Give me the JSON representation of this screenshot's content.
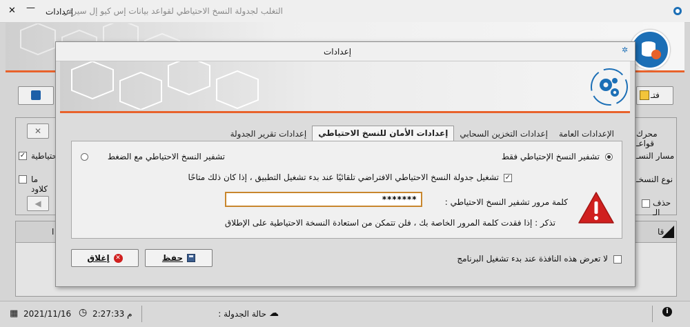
{
  "window": {
    "title": "التغلب لجدولة النسخ الاحتياطي لقواعد بيانات إس كيو إل سيرفر",
    "title_controls_label": "إعدادات",
    "close_glyph": "✕",
    "minimize_glyph": "—"
  },
  "background": {
    "top_button_label": "فتـ",
    "row_labels": [
      "محرك قواعـ",
      "مسار النسـ",
      "نوع النسخـ",
      "حذف الـ"
    ],
    "left_labels": [
      "احتياطية",
      "ما كلاود"
    ],
    "table_header_right": "قا",
    "table_header_left": "ا"
  },
  "status": {
    "date": "2021/11/16",
    "time": "2:27:33 م",
    "schedule_label": "حالة الجدولة :"
  },
  "dialog": {
    "title": "إعدادات",
    "tabs": [
      {
        "label": "الإعدادات العامة",
        "active": false
      },
      {
        "label": "إعدادات التخزين السحابي",
        "active": false
      },
      {
        "label": "إعدادات الأمان للنسخ الاحتياطي",
        "active": true
      },
      {
        "label": "إعدادات تقرير الجدولة",
        "active": false
      }
    ],
    "radio_encrypt_only": "تشفير النسخ الإحتياطي فقط",
    "radio_encrypt_compress": "تشفير النسخ الاحتياطي مع الضغط",
    "checkbox_default_schedule": "تشغيل جدولة النسخ الاحتياطي الافتراضي تلقائيًا عند بدء تشغيل التطبيق ، إذا كان ذلك متاحًا",
    "password_label": "كلمة مرور تشفير النسخ الاحتياطي :",
    "password_value": "*******",
    "warning_text": "تذكر : إذا فقدت كلمة المرور الخاصة بك ، فلن تتمكن من استعادة النسخة الاحتياطية على الإطلاق",
    "dont_show_label": "لا تعرض هذه النافذة عند بدء تشغيل البرنامج",
    "save_button": "حفظ",
    "close_button": "إغلاق"
  },
  "colors": {
    "accent": "#e8622b",
    "brand_blue": "#1c6fb6",
    "warning_red": "#d0201f"
  }
}
